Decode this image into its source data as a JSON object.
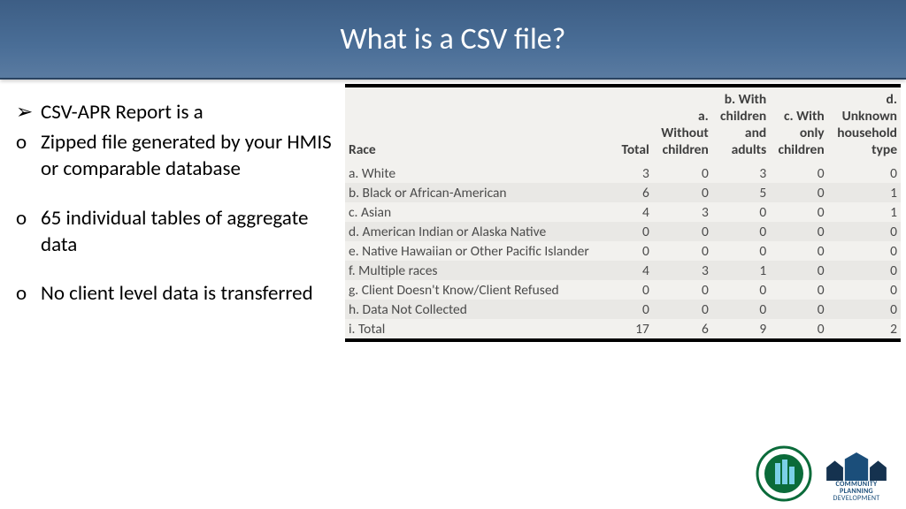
{
  "title": "What is a CSV file?",
  "bullets": [
    {
      "marker": "➢",
      "text": "CSV-APR Report is a"
    },
    {
      "marker": "o",
      "text": " Zipped file generated by your HMIS or comparable database"
    },
    {
      "marker": "",
      "text": ""
    },
    {
      "marker": "o",
      "text": "65 individual tables of aggregate data"
    },
    {
      "marker": "",
      "text": ""
    },
    {
      "marker": "o",
      "text": "No client level data is transferred"
    }
  ],
  "table": {
    "headers": [
      "Race",
      "Total",
      "a. Without children",
      "b. With children and adults",
      "c. With only children",
      "d. Unknown household type"
    ],
    "rows": [
      {
        "label": "a. White",
        "vals": [
          3,
          0,
          3,
          0,
          0
        ]
      },
      {
        "label": "b. Black or African-American",
        "vals": [
          6,
          0,
          5,
          0,
          1
        ]
      },
      {
        "label": "c. Asian",
        "vals": [
          4,
          3,
          0,
          0,
          1
        ]
      },
      {
        "label": "d. American Indian or Alaska Native",
        "vals": [
          0,
          0,
          0,
          0,
          0
        ]
      },
      {
        "label": "e. Native Hawaiian or Other Pacific Islander",
        "vals": [
          0,
          0,
          0,
          0,
          0
        ]
      },
      {
        "label": "f. Multiple races",
        "vals": [
          4,
          3,
          1,
          0,
          0
        ]
      },
      {
        "label": "g. Client Doesn't Know/Client Refused",
        "vals": [
          0,
          0,
          0,
          0,
          0
        ]
      },
      {
        "label": "h. Data Not Collected",
        "vals": [
          0,
          0,
          0,
          0,
          0
        ]
      },
      {
        "label": "i. Total",
        "vals": [
          17,
          6,
          9,
          0,
          2
        ]
      }
    ]
  },
  "chart_data": {
    "type": "table",
    "title": "Race",
    "columns": [
      "Race",
      "Total",
      "a. Without children",
      "b. With children and adults",
      "c. With only children",
      "d. Unknown household type"
    ],
    "rows": [
      [
        "a. White",
        3,
        0,
        3,
        0,
        0
      ],
      [
        "b. Black or African-American",
        6,
        0,
        5,
        0,
        1
      ],
      [
        "c. Asian",
        4,
        3,
        0,
        0,
        1
      ],
      [
        "d. American Indian or Alaska Native",
        0,
        0,
        0,
        0,
        0
      ],
      [
        "e. Native Hawaiian or Other Pacific Islander",
        0,
        0,
        0,
        0,
        0
      ],
      [
        "f. Multiple races",
        4,
        3,
        1,
        0,
        0
      ],
      [
        "g. Client Doesn't Know/Client Refused",
        0,
        0,
        0,
        0,
        0
      ],
      [
        "h. Data Not Collected",
        0,
        0,
        0,
        0,
        0
      ],
      [
        "i. Total",
        17,
        6,
        9,
        0,
        2
      ]
    ]
  },
  "logos": {
    "hud_alt": "HUD Seal",
    "cpd_line1": "COMMUNITY",
    "cpd_line2": "PLANNING",
    "cpd_line3": "DEVELOPMENT"
  }
}
